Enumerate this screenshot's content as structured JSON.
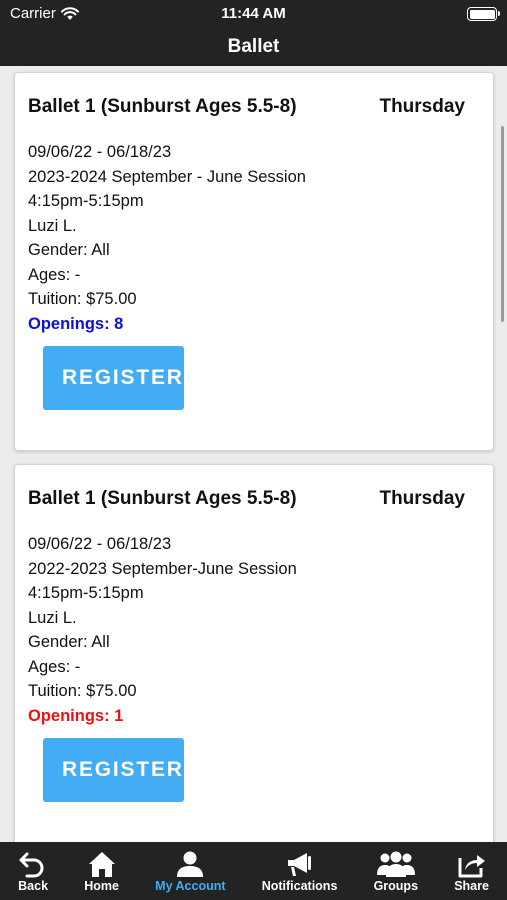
{
  "status_bar": {
    "carrier": "Carrier",
    "time": "11:44 AM"
  },
  "nav_bar": {
    "title": "Ballet"
  },
  "colors": {
    "accent": "#42acf4",
    "openings_ok": "#0a10d4",
    "openings_low": "#ee1111",
    "bar_bg": "#232323"
  },
  "classes": [
    {
      "title": "Ballet 1 (Sunburst Ages 5.5-8)",
      "day": "Thursday",
      "dates": "09/06/22 - 06/18/23",
      "session": "2023-2024 September - June Session",
      "time": "4:15pm-5:15pm",
      "instructor": "Luzi L.",
      "gender": "Gender: All",
      "ages": "Ages: -",
      "tuition": "Tuition: $75.00",
      "openings": "Openings: 8",
      "register_label": "REGISTER"
    },
    {
      "title": "Ballet 1 (Sunburst Ages 5.5-8)",
      "day": "Thursday",
      "dates": "09/06/22 - 06/18/23",
      "session": "2022-2023 September-June Session",
      "time": "4:15pm-5:15pm",
      "instructor": "Luzi L.",
      "gender": "Gender: All",
      "ages": "Ages: -",
      "tuition": "Tuition: $75.00",
      "openings": "Openings: 1",
      "register_label": "REGISTER"
    }
  ],
  "tab_bar": {
    "items": [
      {
        "label": "Back",
        "icon": "back-arrow-icon"
      },
      {
        "label": "Home",
        "icon": "home-icon"
      },
      {
        "label": "My Account",
        "icon": "user-icon",
        "active": true
      },
      {
        "label": "Notifications",
        "icon": "megaphone-icon"
      },
      {
        "label": "Groups",
        "icon": "group-icon"
      },
      {
        "label": "Share",
        "icon": "share-icon"
      }
    ]
  }
}
